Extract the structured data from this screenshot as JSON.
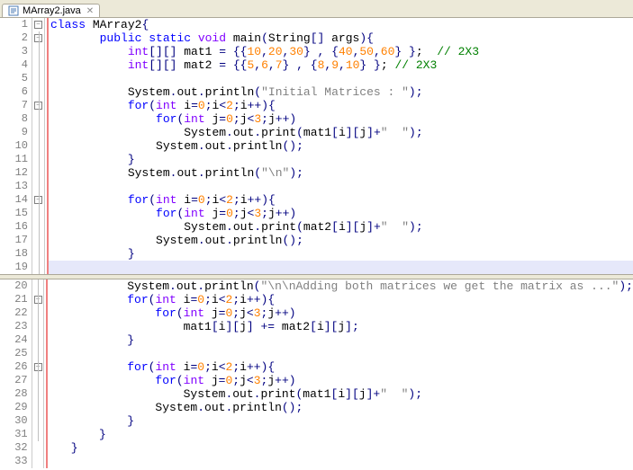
{
  "tab": {
    "filename": "MArray2.java",
    "icon": "java-file-icon"
  },
  "gutter_top": [
    "1",
    "2",
    "3",
    "4",
    "5",
    "6",
    "7",
    "8",
    "9",
    "10",
    "11",
    "12",
    "13",
    "14",
    "15",
    "16",
    "17",
    "18",
    "19"
  ],
  "gutter_bot": [
    "20",
    "21",
    "22",
    "23",
    "24",
    "25",
    "26",
    "27",
    "28",
    "29",
    "30",
    "31",
    "32",
    "33"
  ],
  "code": {
    "l1": {
      "kw1": "class",
      "id": " MArray2",
      "b": "{"
    },
    "l2": {
      "pad": "       ",
      "kw1": "public ",
      "kw2": "static ",
      "ty": "void",
      "id": " main",
      "p1": "(",
      "id2": "String",
      "arr": "[] ",
      "id3": "args",
      "p2": ")",
      "b": "{"
    },
    "l3": {
      "pad": "           ",
      "ty": "int",
      "arr": "[][] ",
      "id": "mat1 ",
      "op": "= ",
      "b1": "{{",
      "n1": "10",
      "c1": ",",
      "n2": "20",
      "c2": ",",
      "n3": "30",
      "b2": "} , {",
      "n4": "40",
      "c3": ",",
      "n5": "50",
      "c4": ",",
      "n6": "60",
      "b3": "} }",
      "sc": ";  ",
      "cm": "// 2X3"
    },
    "l4": {
      "pad": "           ",
      "ty": "int",
      "arr": "[][] ",
      "id": "mat2 ",
      "op": "= ",
      "b1": "{{",
      "n1": "5",
      "c1": ",",
      "n2": "6",
      "c2": ",",
      "n3": "7",
      "b2": "} , {",
      "n4": "8",
      "c3": ",",
      "n5": "9",
      "c4": ",",
      "n6": "10",
      "b3": "} }",
      "sc": "; ",
      "cm": "// 2X3"
    },
    "l5": {
      "pad": ""
    },
    "l6": {
      "pad": "           ",
      "id": "System",
      "d1": ".",
      "id2": "out",
      "d2": ".",
      "id3": "println",
      "p1": "(",
      "str": "\"Initial Matrices : \"",
      "p2": ")",
      "sc": ";"
    },
    "l7": {
      "pad": "           ",
      "kw": "for",
      "p1": "(",
      "ty": "int",
      "sp": " ",
      "id": "i",
      "op1": "=",
      "n1": "0",
      "sc1": ";",
      "id2": "i",
      "op2": "<",
      "n2": "2",
      "sc2": ";",
      "id3": "i",
      "op3": "++",
      "p2": ")",
      "b": "{"
    },
    "l8": {
      "pad": "               ",
      "kw": "for",
      "p1": "(",
      "ty": "int",
      "sp": " ",
      "id": "j",
      "op1": "=",
      "n1": "0",
      "sc1": ";",
      "id2": "j",
      "op2": "<",
      "n2": "3",
      "sc2": ";",
      "id3": "j",
      "op3": "++",
      "p2": ")"
    },
    "l9": {
      "pad": "                   ",
      "id": "System",
      "d1": ".",
      "id2": "out",
      "d2": ".",
      "id3": "print",
      "p1": "(",
      "id4": "mat1",
      "br": "[",
      "id5": "i",
      "br2": "][",
      "id6": "j",
      "br3": "]",
      "op": "+",
      "str": "\"  \"",
      "p2": ")",
      "sc": ";"
    },
    "l10": {
      "pad": "               ",
      "id": "System",
      "d1": ".",
      "id2": "out",
      "d2": ".",
      "id3": "println",
      "p1": "()",
      "sc": ";"
    },
    "l11": {
      "pad": "           ",
      "b": "}"
    },
    "l12": {
      "pad": "           ",
      "id": "System",
      "d1": ".",
      "id2": "out",
      "d2": ".",
      "id3": "println",
      "p1": "(",
      "str": "\"\\n\"",
      "p2": ")",
      "sc": ";"
    },
    "l13": {
      "pad": ""
    },
    "l14": {
      "pad": "           ",
      "kw": "for",
      "p1": "(",
      "ty": "int",
      "sp": " ",
      "id": "i",
      "op1": "=",
      "n1": "0",
      "sc1": ";",
      "id2": "i",
      "op2": "<",
      "n2": "2",
      "sc2": ";",
      "id3": "i",
      "op3": "++",
      "p2": ")",
      "b": "{"
    },
    "l15": {
      "pad": "               ",
      "kw": "for",
      "p1": "(",
      "ty": "int",
      "sp": " ",
      "id": "j",
      "op1": "=",
      "n1": "0",
      "sc1": ";",
      "id2": "j",
      "op2": "<",
      "n2": "3",
      "sc2": ";",
      "id3": "j",
      "op3": "++",
      "p2": ")"
    },
    "l16": {
      "pad": "                   ",
      "id": "System",
      "d1": ".",
      "id2": "out",
      "d2": ".",
      "id3": "print",
      "p1": "(",
      "id4": "mat2",
      "br": "[",
      "id5": "i",
      "br2": "][",
      "id6": "j",
      "br3": "]",
      "op": "+",
      "str": "\"  \"",
      "p2": ")",
      "sc": ";"
    },
    "l17": {
      "pad": "               ",
      "id": "System",
      "d1": ".",
      "id2": "out",
      "d2": ".",
      "id3": "println",
      "p1": "()",
      "sc": ";"
    },
    "l18": {
      "pad": "           ",
      "b": "}"
    },
    "l19": {
      "pad": ""
    },
    "l20": {
      "pad": "           ",
      "id": "System",
      "d1": ".",
      "id2": "out",
      "d2": ".",
      "id3": "println",
      "p1": "(",
      "str": "\"\\n\\nAdding both matrices we get the matrix as ...\"",
      "p2": ")",
      "sc": ";"
    },
    "l21": {
      "pad": "           ",
      "kw": "for",
      "p1": "(",
      "ty": "int",
      "sp": " ",
      "id": "i",
      "op1": "=",
      "n1": "0",
      "sc1": ";",
      "id2": "i",
      "op2": "<",
      "n2": "2",
      "sc2": ";",
      "id3": "i",
      "op3": "++",
      "p2": ")",
      "b": "{"
    },
    "l22": {
      "pad": "               ",
      "kw": "for",
      "p1": "(",
      "ty": "int",
      "sp": " ",
      "id": "j",
      "op1": "=",
      "n1": "0",
      "sc1": ";",
      "id2": "j",
      "op2": "<",
      "n2": "3",
      "sc2": ";",
      "id3": "j",
      "op3": "++",
      "p2": ")"
    },
    "l23": {
      "pad": "                   ",
      "id": "mat1",
      "br": "[",
      "id2": "i",
      "br2": "][",
      "id3": "j",
      "br3": "] ",
      "op": "+= ",
      "id4": "mat2",
      "br4": "[",
      "id5": "i",
      "br5": "][",
      "id6": "j",
      "br6": "]",
      "sc": ";"
    },
    "l24": {
      "pad": "           ",
      "b": "}"
    },
    "l25": {
      "pad": ""
    },
    "l26": {
      "pad": "           ",
      "kw": "for",
      "p1": "(",
      "ty": "int",
      "sp": " ",
      "id": "i",
      "op1": "=",
      "n1": "0",
      "sc1": ";",
      "id2": "i",
      "op2": "<",
      "n2": "2",
      "sc2": ";",
      "id3": "i",
      "op3": "++",
      "p2": ")",
      "b": "{"
    },
    "l27": {
      "pad": "               ",
      "kw": "for",
      "p1": "(",
      "ty": "int",
      "sp": " ",
      "id": "j",
      "op1": "=",
      "n1": "0",
      "sc1": ";",
      "id2": "j",
      "op2": "<",
      "n2": "3",
      "sc2": ";",
      "id3": "j",
      "op3": "++",
      "p2": ")"
    },
    "l28": {
      "pad": "                   ",
      "id": "System",
      "d1": ".",
      "id2": "out",
      "d2": ".",
      "id3": "print",
      "p1": "(",
      "id4": "mat1",
      "br": "[",
      "id5": "i",
      "br2": "][",
      "id6": "j",
      "br3": "]",
      "op": "+",
      "str": "\"  \"",
      "p2": ")",
      "sc": ";"
    },
    "l29": {
      "pad": "               ",
      "id": "System",
      "d1": ".",
      "id2": "out",
      "d2": ".",
      "id3": "println",
      "p1": "()",
      "sc": ";"
    },
    "l30": {
      "pad": "           ",
      "b": "}"
    },
    "l31": {
      "pad": "       ",
      "b": "}"
    },
    "l32": {
      "pad": "   ",
      "b": "}"
    },
    "l33": {
      "pad": ""
    }
  }
}
